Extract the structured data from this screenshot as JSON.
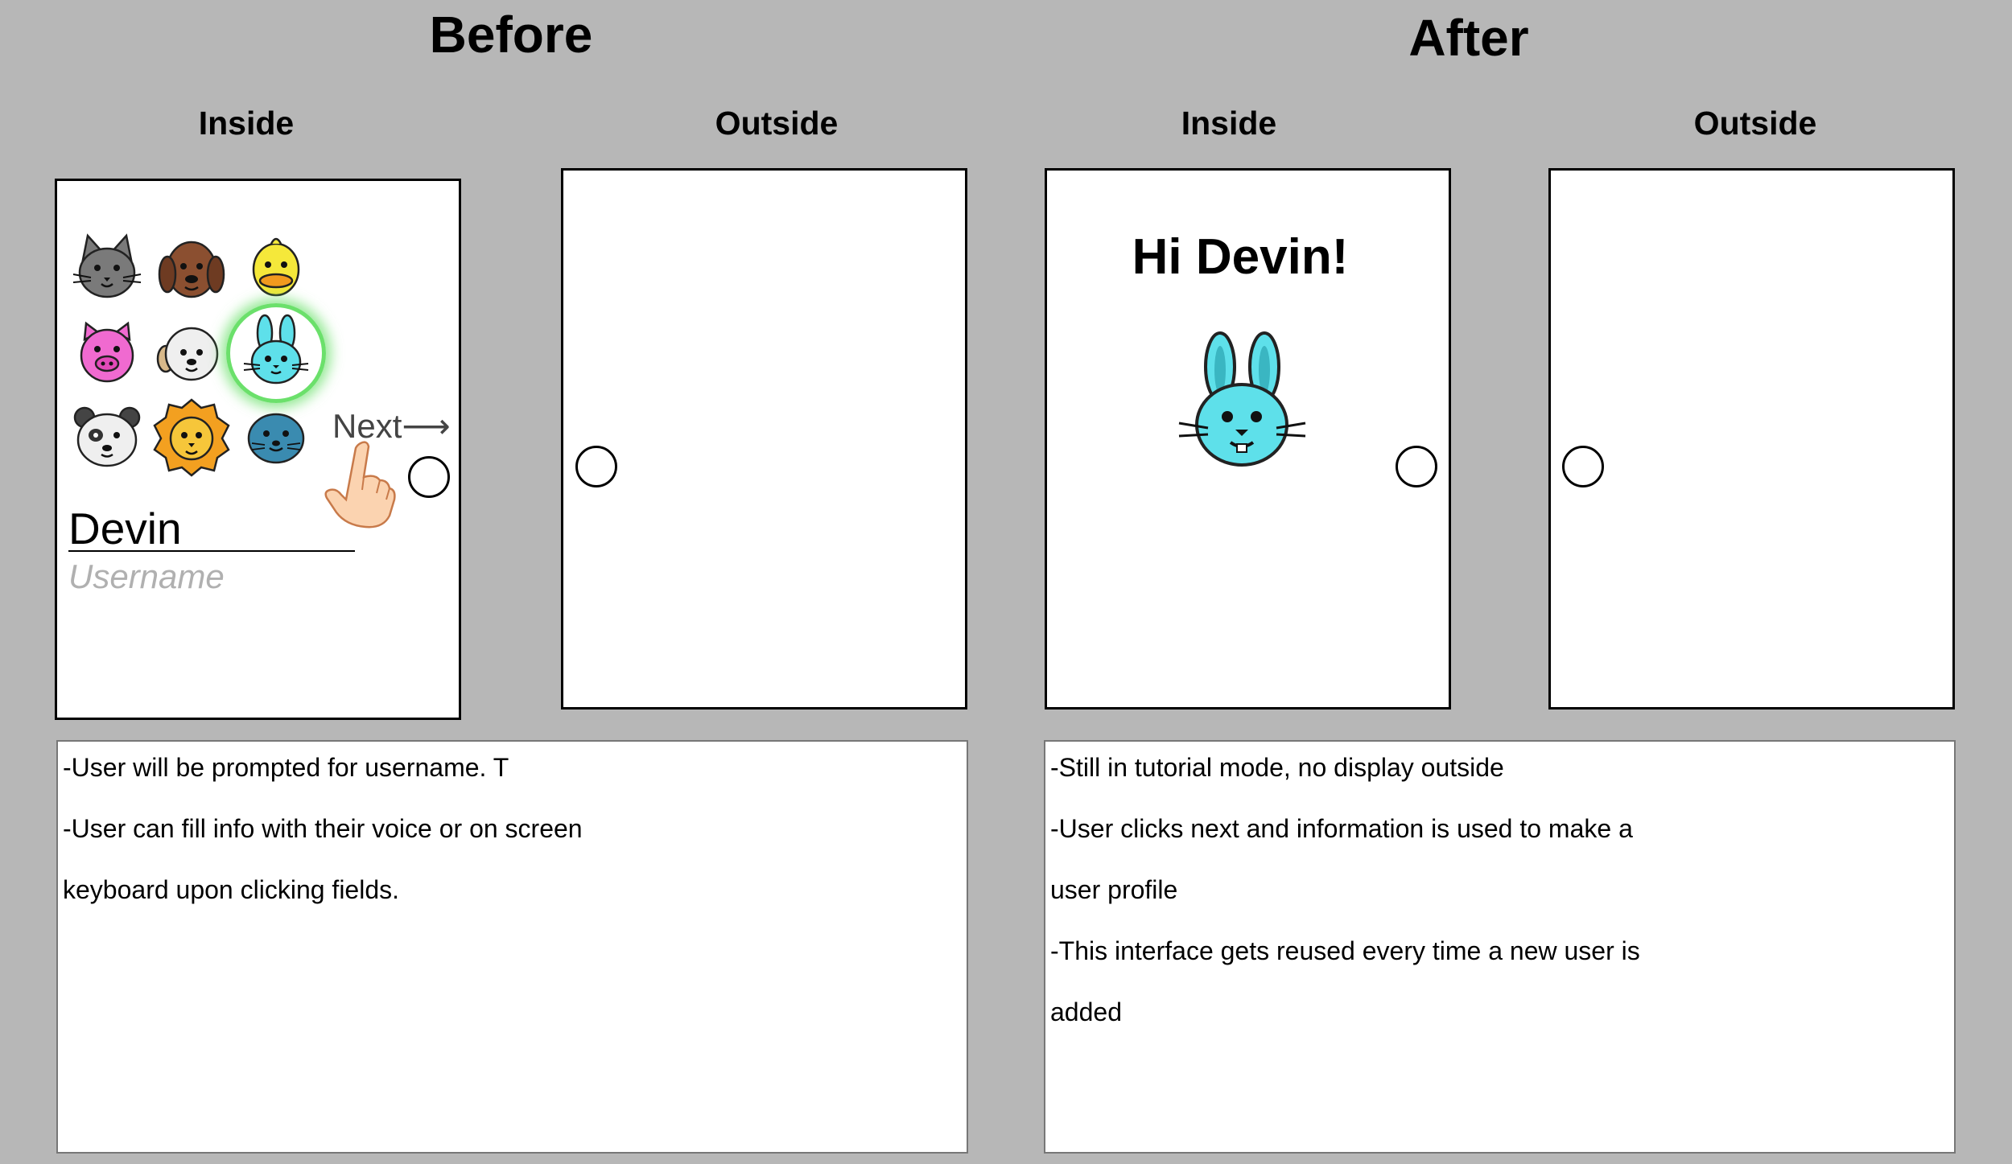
{
  "before": {
    "title": "Before",
    "inside_label": "Inside",
    "outside_label": "Outside",
    "username_value": "Devin",
    "username_placeholder": "Username",
    "next_label": "Next",
    "next_arrow": "⟶",
    "animals": [
      "cat",
      "dog",
      "chick",
      "pig",
      "sheep",
      "bunny",
      "panda",
      "lion",
      "seal"
    ],
    "selected_animal": "bunny",
    "notes": [
      "-User will be prompted for username. T",
      "-User can fill info with their voice or on screen",
      "keyboard upon clicking fields."
    ]
  },
  "after": {
    "title": "After",
    "inside_label": "Inside",
    "outside_label": "Outside",
    "greeting": "Hi Devin!",
    "avatar": "bunny",
    "notes": [
      "-Still in tutorial mode, no display outside",
      "-User clicks next and information is used to make a",
      "user profile",
      "-This interface gets reused every time a new user is",
      "added"
    ]
  },
  "colors": {
    "background": "#b7b7b7",
    "selection_glow": "#6be06b",
    "bunny": "#5ee0ea"
  }
}
